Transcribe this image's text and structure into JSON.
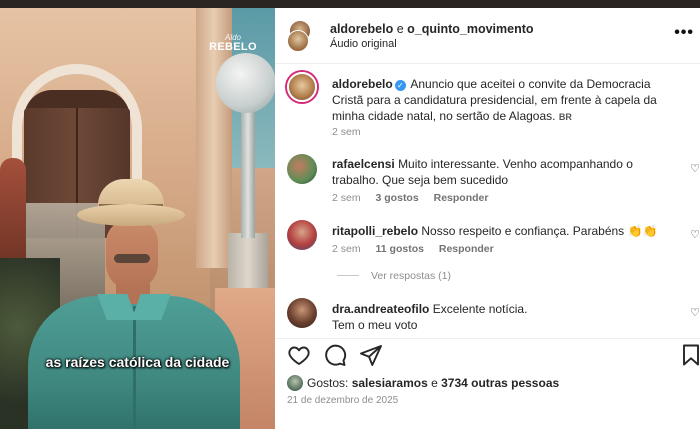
{
  "video": {
    "watermark_small": "Aldo",
    "watermark_large": "REBELO",
    "caption": "as raízes católica da cidade"
  },
  "header": {
    "user1": "aldorebelo",
    "connector": " e ",
    "user2": "o_quinto_movimento",
    "audio": "Áudio original",
    "more_icon": "more-options-icon"
  },
  "post": {
    "author": "aldorebelo",
    "text": "Anuncio que aceitei o convite da Democracia Cristã para a candidatura presidencial, em frente à capela da minha cidade natal, no sertão de Alagoas.",
    "tag": "BR",
    "time": "2 sem"
  },
  "comments": [
    {
      "user": "rafaelcensi",
      "text": "Muito interessante. Venho acompanhando o trabalho. Que seja bem sucedido",
      "time": "2 sem",
      "likes": "3 gostos",
      "reply": "Responder"
    },
    {
      "user": "ritapolli_rebelo",
      "text": "Nosso respeito e confiança. Parabéns 👏👏",
      "time": "2 sem",
      "likes": "11 gostos",
      "reply": "Responder"
    },
    {
      "user": "dra.andreateofilo",
      "text": "Excelente notícia.",
      "text2": "Tem o meu voto"
    }
  ],
  "view_replies": "Ver respostas (1)",
  "likes": {
    "prefix": "Gostos: ",
    "user": "salesiaramos",
    "connector": " e ",
    "others": "3734 outras pessoas"
  },
  "date": "21 de dezembro de 2025",
  "colors": {
    "verified": "#3897f0",
    "meta": "#8e8e8e",
    "text": "#262626"
  }
}
